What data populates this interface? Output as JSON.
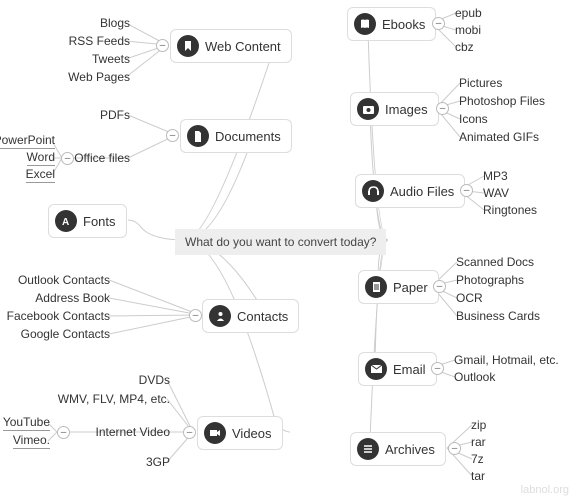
{
  "center": {
    "text": "What do you want to convert today?"
  },
  "watermark": "labnol.org",
  "toggle_glyph": "–",
  "left": {
    "web_content": {
      "label": "Web Content",
      "children": {
        "c0": "Blogs",
        "c1": "RSS Feeds",
        "c2": "Tweets",
        "c3": "Web Pages"
      }
    },
    "documents": {
      "label": "Documents",
      "children": {
        "c0": "PDFs"
      },
      "sub": {
        "label": "Office files",
        "children": {
          "c0": "PowerPoint",
          "c1": "Word",
          "c2": "Excel"
        }
      }
    },
    "fonts": {
      "label": "Fonts"
    },
    "contacts": {
      "label": "Contacts",
      "children": {
        "c0": "Outlook Contacts",
        "c1": "Address Book",
        "c2": "Facebook Contacts",
        "c3": "Google Contacts"
      }
    },
    "videos": {
      "label": "Videos",
      "children": {
        "c0": "DVDs",
        "c1": "WMV, FLV, MP4, etc.",
        "c2": "3GP"
      },
      "sub": {
        "label": "Internet Video",
        "children": {
          "c0": "YouTube",
          "c1": "Vimeo."
        }
      }
    }
  },
  "right": {
    "ebooks": {
      "label": "Ebooks",
      "children": {
        "c0": "epub",
        "c1": "mobi",
        "c2": "cbz"
      }
    },
    "images": {
      "label": "Images",
      "children": {
        "c0": "Pictures",
        "c1": "Photoshop Files",
        "c2": "Icons",
        "c3": "Animated GIFs"
      }
    },
    "audio_files": {
      "label": "Audio Files",
      "children": {
        "c0": "MP3",
        "c1": "WAV",
        "c2": "Ringtones"
      }
    },
    "paper": {
      "label": "Paper",
      "children": {
        "c0": "Scanned Docs",
        "c1": "Photographs",
        "c2": "OCR",
        "c3": "Business Cards"
      }
    },
    "email": {
      "label": "Email",
      "children": {
        "c0": "Gmail, Hotmail, etc.",
        "c1": "Outlook"
      }
    },
    "archives": {
      "label": "Archives",
      "children": {
        "c0": "zip",
        "c1": "rar",
        "c2": "7z",
        "c3": "tar"
      }
    }
  }
}
